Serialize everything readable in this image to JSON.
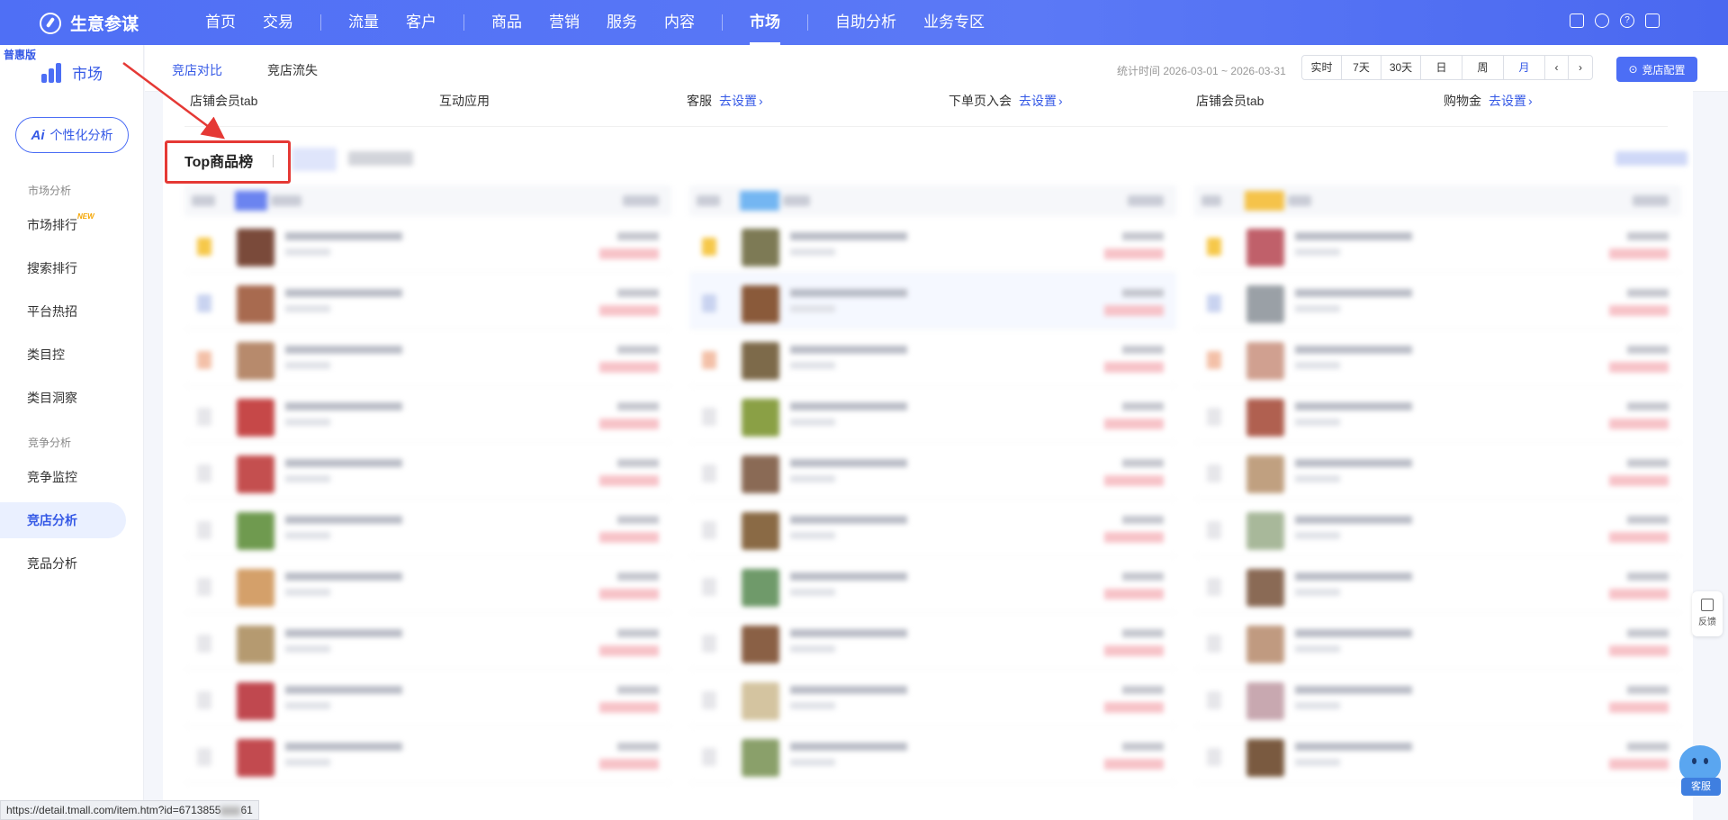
{
  "brand": {
    "name": "生意参谋"
  },
  "nav": {
    "items": [
      "首页",
      "交易",
      "流量",
      "客户",
      "商品",
      "营销",
      "服务",
      "内容",
      "市场",
      "自助分析",
      "业务专区"
    ],
    "active": "市场"
  },
  "sidebar": {
    "edition": "普惠版",
    "app_title": "市场",
    "ai_button": "个性化分析",
    "group_market": "市场分析",
    "group_competition": "竞争分析",
    "items": [
      "市场排行",
      "搜索排行",
      "平台热招",
      "类目控",
      "类目洞察",
      "竞争监控",
      "竞店分析",
      "竞品分析"
    ],
    "new_badge": "NEW",
    "active": "竞店分析"
  },
  "content": {
    "tabs": [
      "竞店对比",
      "竞店流失"
    ],
    "active_tab": "竞店对比",
    "stat_time": "统计时间 2026-03-01 ~ 2026-03-31",
    "periods": [
      "实时",
      "7天",
      "30天",
      "日",
      "周",
      "月"
    ],
    "selected_period": "月",
    "config_button": "竞店配置"
  },
  "settings_row": [
    {
      "label": "店铺会员tab",
      "link": ""
    },
    {
      "label": "互动应用",
      "link": ""
    },
    {
      "label": "客服",
      "link": "去设置"
    },
    {
      "label": "下单页入会",
      "link": "去设置"
    },
    {
      "label": "店铺会员tab",
      "link": ""
    },
    {
      "label": "购物金",
      "link": "去设置"
    }
  ],
  "section_title": "Top商品榜",
  "status_url": "https://detail.tmall.com/item.htm?id=6713855",
  "status_url_tail": "61",
  "feedback_label": "反馈",
  "customer_service_label": "客服",
  "colors": {
    "primary": "#4c6ef5",
    "highlight": "#e53935"
  }
}
